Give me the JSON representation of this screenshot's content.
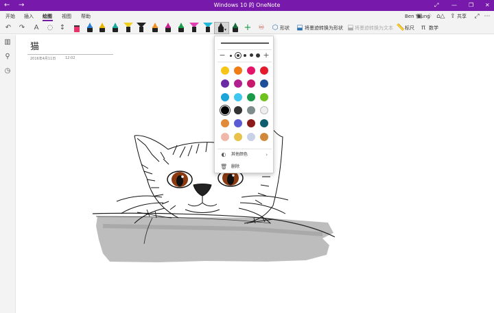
{
  "window": {
    "title": "Windows 10 的 OneNote",
    "back_icon": "back-arrow-icon",
    "forward_icon": "forward-arrow-icon",
    "accent_color": "#7719aa"
  },
  "ribbon": {
    "tabs": [
      {
        "label": "开始"
      },
      {
        "label": "插入"
      },
      {
        "label": "绘图"
      },
      {
        "label": "视图"
      },
      {
        "label": "帮助"
      }
    ],
    "active_tab": "绘图",
    "user_name": "Ben Young",
    "share_label": "共享"
  },
  "toolbar": {
    "shape_label": "形状",
    "ink_to_shape_label": "将墨迹转换为形状",
    "ink_to_text_label": "将墨迹转换为文本",
    "ruler_label": "标尺",
    "math_label": "数学"
  },
  "page": {
    "title": "猫",
    "date": "2016年4月11日",
    "time": "12:02"
  },
  "pen_menu": {
    "colors": [
      [
        "#f5c518",
        "#f07c16",
        "#e3146a",
        "#e31b2d"
      ],
      [
        "#6b2aa5",
        "#b0208e",
        "#c71a6a",
        "#1f4f99"
      ],
      [
        "#1da4d8",
        "#3ec8f0",
        "#1b9a4a",
        "#6fc21e"
      ],
      [
        "#000000",
        "#333333",
        "#7f8c8d",
        "#eeeeee"
      ],
      [
        "#e08a3a",
        "#5b5bd6",
        "#8b1a1a",
        "#0d5d6e"
      ],
      [
        "#f0b8a8",
        "#e8c14a",
        "#c9d1e8",
        "#d0883a"
      ]
    ],
    "selected_color": "#000000",
    "more_colors_label": "其他颜色",
    "delete_label": "删除"
  }
}
